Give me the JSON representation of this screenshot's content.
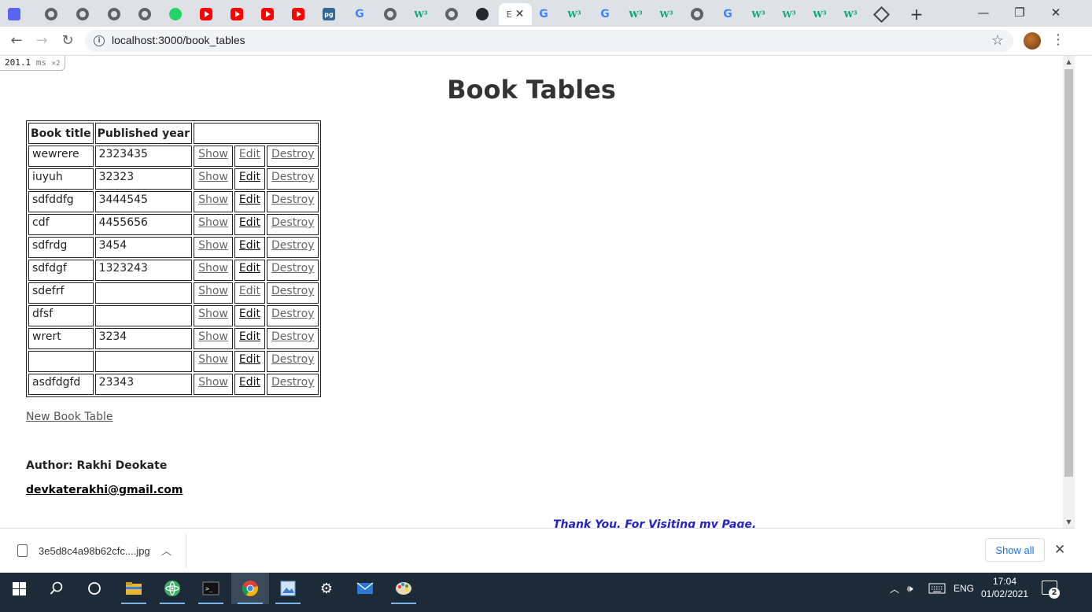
{
  "browser": {
    "active_tab_letter": "E",
    "url": "localhost:3000/book_tables",
    "new_tab_symbol": "+",
    "window_controls": {
      "minimize": "—",
      "maximize": "❐",
      "close": "✕"
    }
  },
  "perf_badge": {
    "value": "201.1",
    "unit": "ms",
    "multiplier": "×2"
  },
  "page": {
    "title": "Book Tables",
    "table": {
      "headers": [
        "Book title",
        "Published year",
        ""
      ],
      "rows": [
        {
          "title": "wewrere",
          "year": "2323435",
          "show": "Show",
          "edit": "Edit",
          "destroy": "Destroy",
          "edit_visited": true
        },
        {
          "title": "iuyuh",
          "year": "32323",
          "show": "Show",
          "edit": "Edit",
          "destroy": "Destroy",
          "edit_visited": false
        },
        {
          "title": "sdfddfg",
          "year": "3444545",
          "show": "Show",
          "edit": "Edit",
          "destroy": "Destroy",
          "edit_visited": false
        },
        {
          "title": "cdf",
          "year": "4455656",
          "show": "Show",
          "edit": "Edit",
          "destroy": "Destroy",
          "edit_visited": false
        },
        {
          "title": "sdfrdg",
          "year": "3454",
          "show": "Show",
          "edit": "Edit",
          "destroy": "Destroy",
          "edit_visited": false
        },
        {
          "title": "sdfdgf",
          "year": "1323243",
          "show": "Show",
          "edit": "Edit",
          "destroy": "Destroy",
          "edit_visited": false
        },
        {
          "title": "sdefrf",
          "year": "",
          "show": "Show",
          "edit": "Edit",
          "destroy": "Destroy",
          "edit_visited": true
        },
        {
          "title": "dfsf",
          "year": "",
          "show": "Show",
          "edit": "Edit",
          "destroy": "Destroy",
          "edit_visited": false
        },
        {
          "title": "wrert",
          "year": "3234",
          "show": "Show",
          "edit": "Edit",
          "destroy": "Destroy",
          "edit_visited": false
        },
        {
          "title": "",
          "year": "",
          "show": "Show",
          "edit": "Edit",
          "destroy": "Destroy",
          "edit_visited": false
        },
        {
          "title": "asdfdgfd",
          "year": "23343",
          "show": "Show",
          "edit": "Edit",
          "destroy": "Destroy",
          "edit_visited": false
        }
      ]
    },
    "new_link": "New Book Table",
    "author": "Author: Rakhi Deokate",
    "email": "devkaterakhi@gmail.com",
    "thanks": "Thank You. For Visiting my Page."
  },
  "download_bar": {
    "file_name": "3e5d8c4a98b62cfc....jpg",
    "show_all": "Show all",
    "close": "✕"
  },
  "taskbar": {
    "language": "ENG",
    "time": "17:04",
    "date": "01/02/2021",
    "notification_count": "2"
  },
  "colors": {
    "link_visited": "#666666",
    "link_default": "#111111",
    "thanks_text": "#2323c8",
    "taskbar_bg": "#1d2b38"
  }
}
